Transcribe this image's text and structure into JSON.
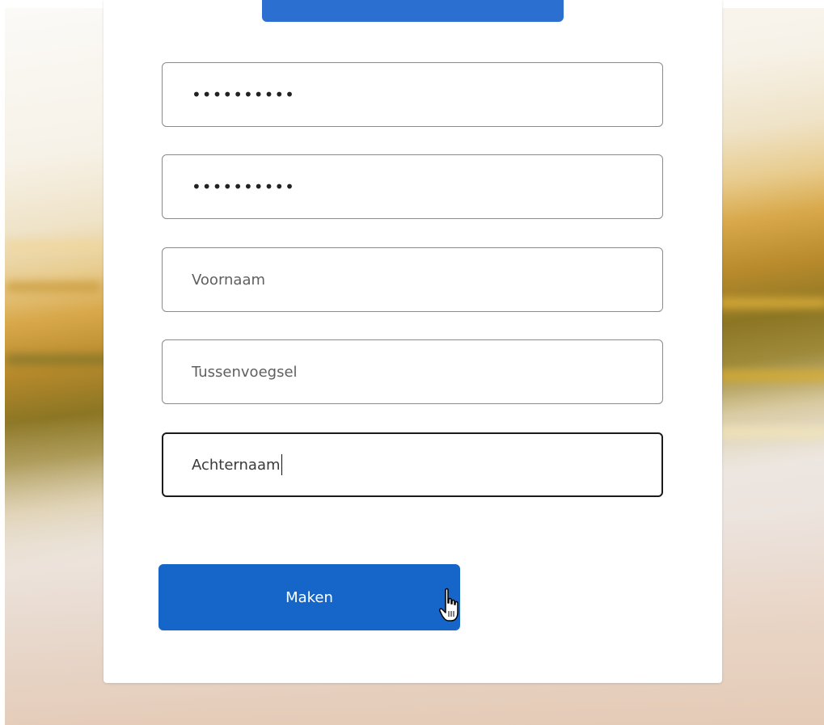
{
  "form": {
    "password": {
      "value": "••••••••••"
    },
    "password_confirm": {
      "value": "••••••••••"
    },
    "first_name": {
      "placeholder": "Voornaam"
    },
    "middle_name": {
      "placeholder": "Tussenvoegsel"
    },
    "last_name": {
      "value": "Achternaam"
    },
    "submit_label": "Maken"
  },
  "colors": {
    "primary": "#1665c8",
    "focus_border": "#1b1b1b",
    "field_border": "#8a8a8a"
  },
  "icons": {
    "cursor": "hand-pointer-icon"
  }
}
